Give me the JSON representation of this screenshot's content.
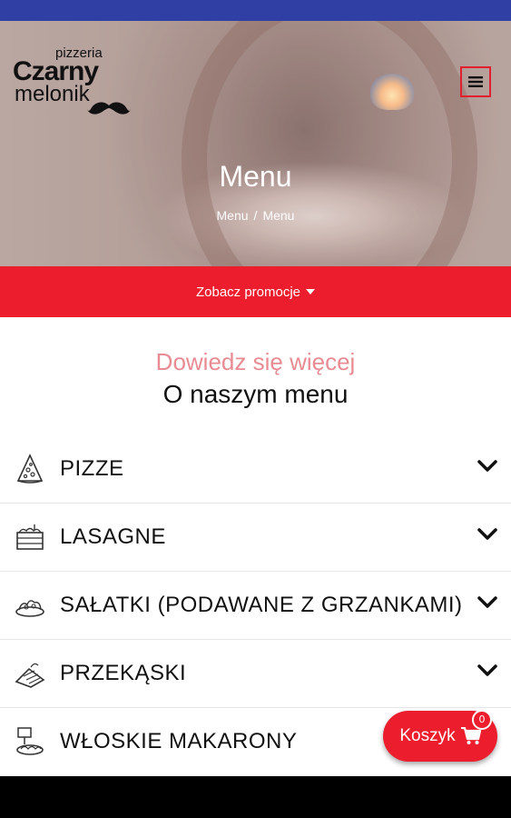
{
  "header": {
    "logo_small": "pizzeria",
    "logo_main": "Czarny",
    "logo_sub": "melonik",
    "menu_icon": "hamburger-icon",
    "title": "Menu",
    "breadcrumb": [
      "Menu",
      "Menu"
    ],
    "breadcrumb_separator": "/"
  },
  "promo": {
    "label": "Zobacz promocje",
    "icon": "caret-down-icon"
  },
  "section": {
    "subtitle": "Dowiedz się więcej",
    "title": "O naszym menu"
  },
  "menu": {
    "items": [
      {
        "label": "PIZZE",
        "icon": "pizza-slice-icon"
      },
      {
        "label": "LASAGNE",
        "icon": "lasagne-icon"
      },
      {
        "label": "SAŁATKI (PODAWANE Z GRZANKAMI)",
        "icon": "salad-icon"
      },
      {
        "label": "PRZEKĄSKI",
        "icon": "snack-icon"
      },
      {
        "label": "WŁOSKIE MAKARONY",
        "icon": "pasta-icon"
      }
    ]
  },
  "cart": {
    "label": "Koszyk",
    "count": "0",
    "icon": "cart-icon"
  },
  "colors": {
    "accent": "#ec1d2c",
    "status_bar": "#2f3fa3",
    "subtitle": "#e88b93"
  }
}
